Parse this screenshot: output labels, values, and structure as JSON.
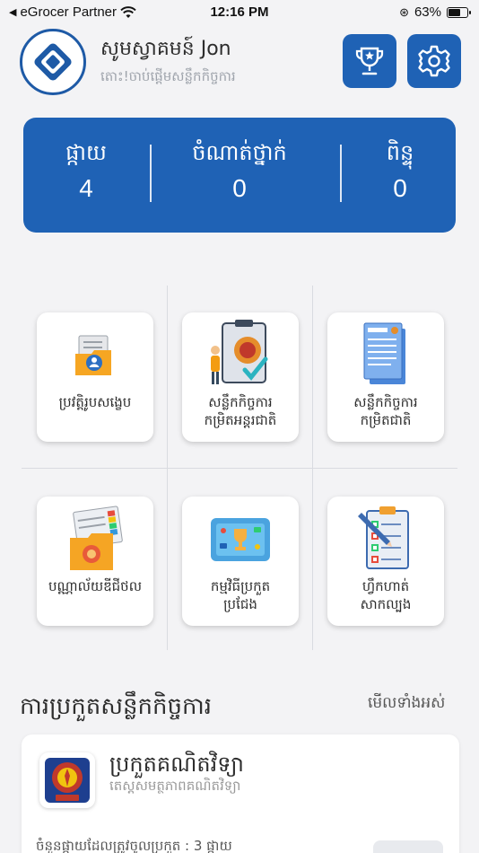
{
  "status_bar": {
    "back_app": "eGrocer Partner",
    "time": "12:16 PM",
    "battery": "63%",
    "battery_level": 0.63
  },
  "header": {
    "greeting": "សូមស្វាគមន៍ Jon",
    "subtitle": "តោះ!ចាប់ផ្តើមសន្លឹកកិច្ចការ"
  },
  "stats": [
    {
      "label": "ផ្កាយ",
      "value": "4"
    },
    {
      "label": "ចំណាត់ថ្នាក់",
      "value": "0"
    },
    {
      "label": "ពិន្ទុ",
      "value": "0"
    }
  ],
  "menu": [
    {
      "label": "ប្រវត្តិរូបសង្ខេប",
      "icon": "profile-folder-icon"
    },
    {
      "label": "សន្លឹកកិច្ចការ\nកម្រិតអន្តរជាតិ",
      "icon": "international-worksheet-icon"
    },
    {
      "label": "សន្លឹកកិច្ចការ\nកម្រិតជាតិ",
      "icon": "national-worksheet-icon"
    },
    {
      "label": "បណ្ណាល័យឌីជីថល",
      "icon": "digital-library-icon"
    },
    {
      "label": "កម្មវិធីប្រកួត\nប្រជែង",
      "icon": "competition-icon"
    },
    {
      "label": "ហ្វឹកហាត់\nសាកល្បង",
      "icon": "practice-test-icon"
    }
  ],
  "section": {
    "title": "ការប្រកួតសន្លឹកកិច្ចការ",
    "see_all": "មើលទាំងអស់"
  },
  "quiz": {
    "title": "ប្រកួតគណិតវិទ្យា",
    "subtitle": "តេស្តសមត្ថភាពគណិតវិទ្យា",
    "count": "ចំនួនផ្កាយដែលត្រូវចូលប្រកួត : 3 ផ្កាយ"
  },
  "colors": {
    "primary": "#1f62b5",
    "background": "#f3f3f5"
  }
}
